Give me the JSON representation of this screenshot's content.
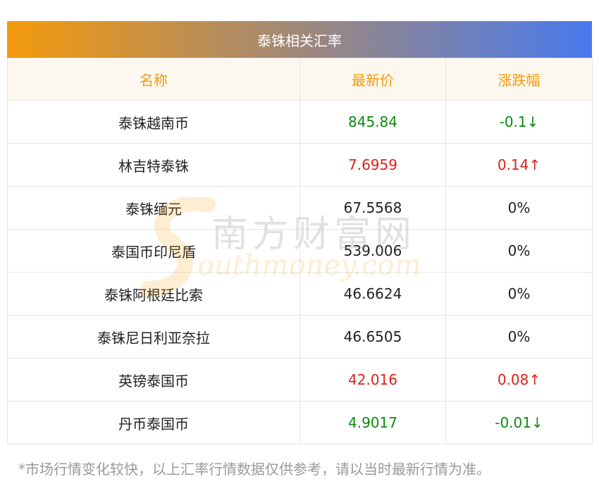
{
  "title": "泰铢相关汇率",
  "columns": {
    "name": "名称",
    "price": "最新价",
    "change": "涨跌幅"
  },
  "rows": [
    {
      "name": "泰铢越南币",
      "price": "845.84",
      "change": "-0.1↓",
      "trend": "down"
    },
    {
      "name": "林吉特泰铢",
      "price": "7.6959",
      "change": "0.14↑",
      "trend": "up"
    },
    {
      "name": "泰铢缅元",
      "price": "67.5568",
      "change": "0%",
      "trend": "flat"
    },
    {
      "name": "泰国币印尼盾",
      "price": "539.006",
      "change": "0%",
      "trend": "flat"
    },
    {
      "name": "泰铢阿根廷比索",
      "price": "46.6624",
      "change": "0%",
      "trend": "flat"
    },
    {
      "name": "泰铢尼日利亚奈拉",
      "price": "46.6505",
      "change": "0%",
      "trend": "flat"
    },
    {
      "name": "英镑泰国币",
      "price": "42.016",
      "change": "0.08↑",
      "trend": "up"
    },
    {
      "name": "丹币泰国币",
      "price": "4.9017",
      "change": "-0.01↓",
      "trend": "down"
    }
  ],
  "watermark": {
    "chinese": "南方财富网",
    "english": "outhmoney.com"
  },
  "footnote": "*市场行情变化较快，以上汇率行情数据仅供参考，请以当时最新行情为准。",
  "colors": {
    "up": "#e0201b",
    "down": "#0e8a0e",
    "header_text": "#f39a0b"
  }
}
